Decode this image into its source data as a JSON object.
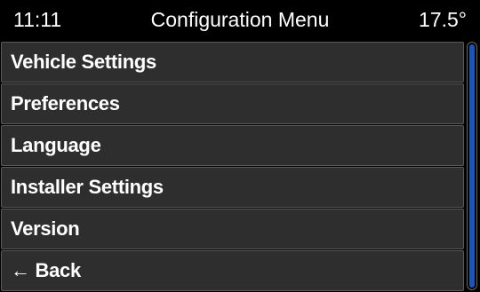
{
  "header": {
    "time": "11:11",
    "title": "Configuration Menu",
    "temperature": "17.5°"
  },
  "menu": {
    "items": [
      {
        "label": "Vehicle Settings"
      },
      {
        "label": "Preferences"
      },
      {
        "label": "Language"
      },
      {
        "label": "Installer Settings"
      },
      {
        "label": "Version"
      },
      {
        "label": "← Back"
      }
    ]
  },
  "colors": {
    "background": "#000000",
    "item_background": "#2e2e2e",
    "item_border": "#5a5a5a",
    "scroll_thumb": "#1a55b8",
    "text": "#ffffff"
  }
}
